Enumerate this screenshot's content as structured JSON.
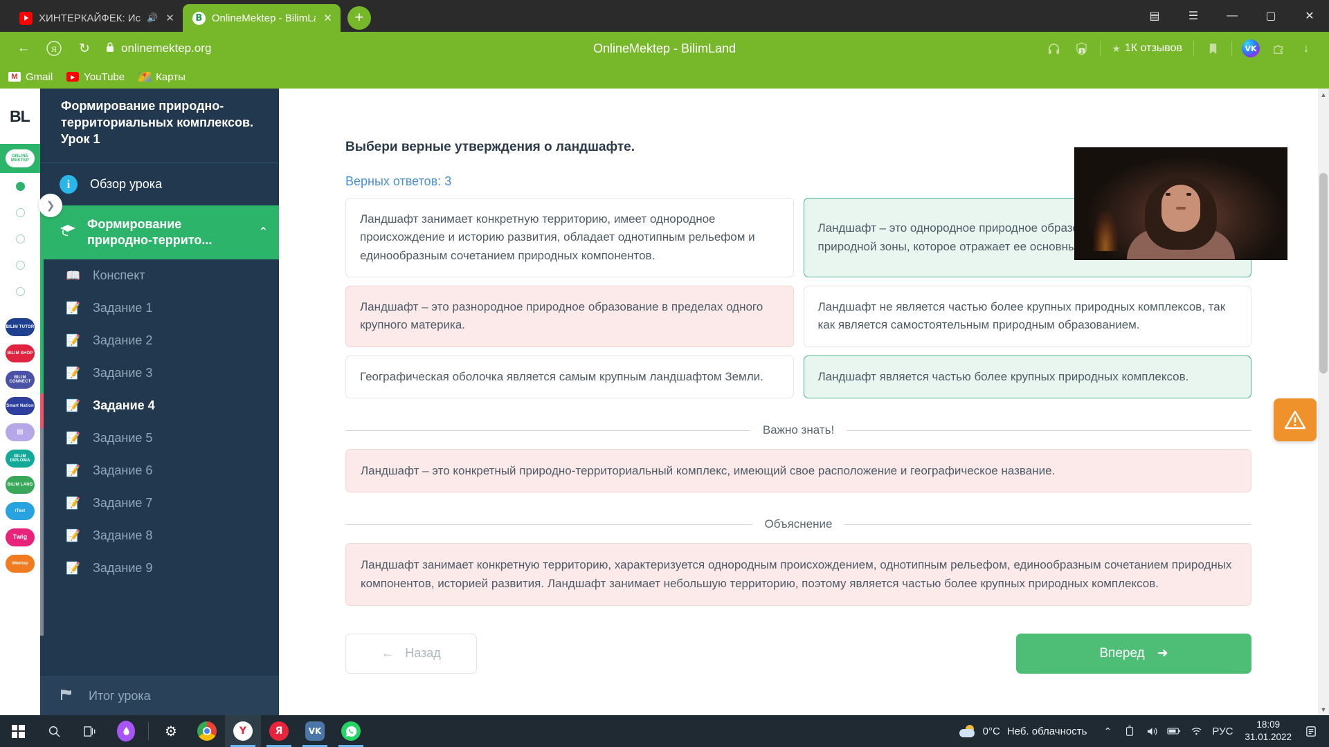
{
  "browser": {
    "tabs": [
      {
        "title": "ХИНТЕРКАЙФЕК: Ис",
        "favicon": "youtube-icon",
        "muted": true,
        "active": false
      },
      {
        "title": "OnlineMektep - BilimLa",
        "favicon": "bilimland-icon",
        "muted": false,
        "active": true
      }
    ],
    "new_tab_label": "+",
    "window_controls": {
      "collections": "▤",
      "menu": "☰",
      "minimize": "—",
      "maximize": "▢",
      "close": "✕"
    },
    "nav": {
      "back": "←",
      "yandex": "Я",
      "reload": "↻",
      "lock": "🔒",
      "url": "onlinemektep.org",
      "page_title": "OnlineMektep - BilimLand"
    },
    "nav_right": {
      "headphones_icon": "headphones-icon",
      "shield_count": "1",
      "reviews_label": "1К отзывов",
      "star_icon": "star-icon",
      "bookmark_icon": "bookmark-icon",
      "vk_label": "VK",
      "puzzle_icon": "puzzle-icon",
      "download_icon": "↓"
    },
    "bookmarks": [
      {
        "label": "Gmail",
        "icon": "gmail-icon"
      },
      {
        "label": "YouTube",
        "icon": "youtube-icon"
      },
      {
        "label": "Карты",
        "icon": "maps-icon"
      }
    ]
  },
  "rail": {
    "logo": "BL",
    "expand_arrow": "❯",
    "active_app": "ONLINE MEKTEP",
    "dots": [
      "filled",
      "empty",
      "empty",
      "empty",
      "empty"
    ],
    "apps": [
      {
        "name": "BILIM TUTOR",
        "color": "#1f3f8f"
      },
      {
        "name": "BILIM SHOP",
        "color": "#e0243f"
      },
      {
        "name": "BILIM CONNECT",
        "color": "#4a52a8"
      },
      {
        "name": "Smart Nation",
        "color": "#2f3f9e"
      },
      {
        "name": "BILIM CARD",
        "color": "#b6a8e8"
      },
      {
        "name": "BILIM DIPLOMA",
        "color": "#13a99a"
      },
      {
        "name": "BILIM LAND",
        "color": "#3aa85a"
      },
      {
        "name": "iTest",
        "color": "#29a3e0"
      },
      {
        "name": "Twig",
        "color": "#e8247a"
      },
      {
        "name": "iMektep",
        "color": "#f07b20"
      }
    ]
  },
  "sidebar": {
    "lesson_title": "Формирование природно-территориальных комплексов. Урок 1",
    "overview": {
      "label": "Обзор урока",
      "icon": "info-icon"
    },
    "chapter": {
      "label": "Формирование природно-террито...",
      "icon": "graduation-cap-icon",
      "chevron": "⌃"
    },
    "items": [
      {
        "label": "Конспект",
        "icon": "book-icon",
        "state": "done",
        "icon_color": "#2cb56a",
        "strip": "#2cb56a"
      },
      {
        "label": "Задание 1",
        "icon": "edit-icon",
        "state": "done",
        "icon_color": "#2cb56a",
        "strip": "#2cb56a"
      },
      {
        "label": "Задание 2",
        "icon": "edit-icon",
        "state": "done",
        "icon_color": "#2cb56a",
        "strip": "#2cb56a"
      },
      {
        "label": "Задание 3",
        "icon": "edit-icon",
        "state": "done",
        "icon_color": "#2cb56a",
        "strip": "#2cb56a"
      },
      {
        "label": "Задание 4",
        "icon": "edit-icon",
        "state": "current",
        "icon_color": "#f0546a",
        "strip": "#f0546a"
      },
      {
        "label": "Задание 5",
        "icon": "edit-icon",
        "state": "next",
        "icon_color": "#ffffff",
        "strip": "#7b8794"
      },
      {
        "label": "Задание 6",
        "icon": "edit-icon",
        "state": "todo",
        "icon_color": "#6b7d90",
        "strip": "#7b8794"
      },
      {
        "label": "Задание 7",
        "icon": "edit-icon",
        "state": "todo",
        "icon_color": "#6b7d90",
        "strip": "#7b8794"
      },
      {
        "label": "Задание 8",
        "icon": "edit-icon",
        "state": "todo",
        "icon_color": "#6b7d90",
        "strip": "#7b8794"
      },
      {
        "label": "Задание 9",
        "icon": "edit-icon",
        "state": "todo",
        "icon_color": "#6b7d90",
        "strip": "#7b8794"
      }
    ],
    "footer": {
      "label": "Итог урока",
      "icon": "flag-icon"
    }
  },
  "content": {
    "question": "Выбери верные утверждения о ландшафте.",
    "correct_count_label": "Верных ответов: 3",
    "options": [
      {
        "text": "Ландшафт занимает конкретную территорию, имеет однородное происхождение и историю развития, обладает однотипным рельефом и единообразным сочетанием природных компонентов.",
        "state": "neutral"
      },
      {
        "text": "Ландшафт – это однородное природное образование в пределах природной зоны, которое отражает ее основные особенности.",
        "state": "correct"
      },
      {
        "text": "Ландшафт – это разнородное природное образование в пределах одного крупного материка.",
        "state": "wrong"
      },
      {
        "text": "Ландшафт не является частью более крупных природных комплексов, так как является самостоятельным природным образованием.",
        "state": "neutral"
      },
      {
        "text": "Географическая оболочка является самым крупным ландшафтом Земли.",
        "state": "neutral"
      },
      {
        "text": "Ландшафт является частью более крупных природных комплексов.",
        "state": "correct"
      }
    ],
    "important_heading": "Важно знать!",
    "important_text": "Ландшафт – это конкретный природно-территориальный комплекс, имеющий свое расположение и географическое название.",
    "explanation_heading": "Объяснение",
    "explanation_text": "Ландшафт занимает конкретную территорию, характеризуется однородным происхождением, однотипным рельефом, единообразным сочетанием природных компонентов, историей развития. Ландшафт занимает небольшую территорию, поэтому является частью более крупных природных комплексов.",
    "back_button": "Назад",
    "back_arrow": "←",
    "forward_button": "Вперед",
    "forward_arrow": "➜",
    "warn_icon": "warning-triangle-icon"
  },
  "taskbar": {
    "start_icon": "windows-start-icon",
    "search_icon": "search-icon",
    "taskview_icon": "task-view-icon",
    "apps": [
      {
        "name": "app-purple-drop",
        "label": "",
        "color": "#a855f7"
      },
      {
        "name": "settings-gear",
        "label": "⚙",
        "color": "#ffffff"
      },
      {
        "name": "google-chrome",
        "label": "",
        "color": "#4285f4"
      },
      {
        "name": "yandex-browser",
        "label": "Y",
        "color": "#ffffff"
      },
      {
        "name": "yandex",
        "label": "Я",
        "color": "#e8243c"
      },
      {
        "name": "vk",
        "label": "VK",
        "color": "#4a76a8"
      },
      {
        "name": "whatsapp",
        "label": "",
        "color": "#25d366"
      }
    ],
    "weather": {
      "temp": "0°C",
      "desc": "Неб. облачность"
    },
    "tray": {
      "chevron": "⌃",
      "device": "▯",
      "volume": "🔊",
      "battery": "▭",
      "wifi": "📶",
      "lang": "РУС"
    },
    "clock": {
      "time": "18:09",
      "date": "31.01.2022"
    },
    "notifications_icon": "notifications-icon"
  }
}
